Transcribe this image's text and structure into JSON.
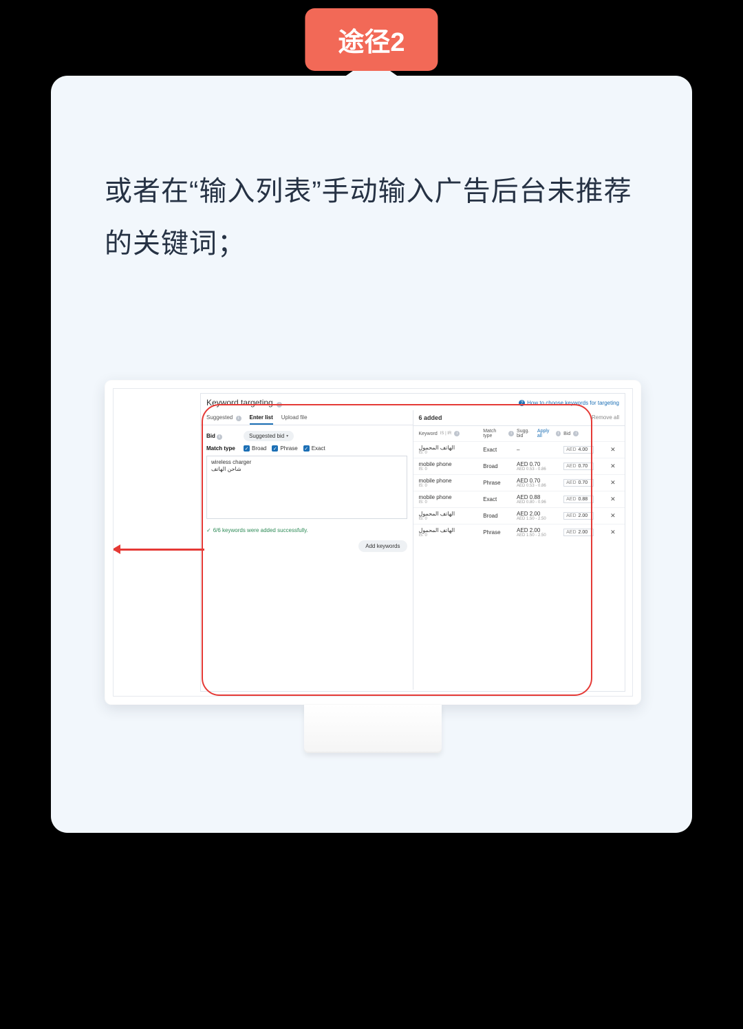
{
  "badge": "途径2",
  "description": "或者在“输入列表”手动输入广告后台未推荐的关键词；",
  "panel": {
    "title": "Keyword targeting",
    "helpLink": "How to choose keywords for targeting",
    "tabs": {
      "suggested": "Suggested",
      "enterList": "Enter list",
      "uploadFile": "Upload file"
    },
    "bidLabel": "Bid",
    "bidDropdown": "Suggested bid",
    "matchLabel": "Match type",
    "matchOptions": {
      "broad": "Broad",
      "phrase": "Phrase",
      "exact": "Exact"
    },
    "textarea": {
      "line1": "wireless charger",
      "line2": "شاحن الهاتف"
    },
    "successMsg": "6/6 keywords were added successfully.",
    "addBtn": "Add keywords",
    "addedTitle": "6 added",
    "removeAll": "Remove all",
    "headers": {
      "keyword": "Keyword",
      "keywordSub": "IS | IR",
      "match": "Match type",
      "sugg": "Sugg. bid",
      "applyAll": "Apply all",
      "bid": "Bid"
    },
    "rows": [
      {
        "kw": "الهاتف المحمول",
        "sub": "IS: 0",
        "match": "Exact",
        "sugg": "–",
        "range": "",
        "cur": "AED",
        "bid": "4.00"
      },
      {
        "kw": "mobile phone",
        "sub": "IS: 0",
        "match": "Broad",
        "sugg": "AED 0.70",
        "range": "AED 0.53 - 0.86",
        "cur": "AED",
        "bid": "0.70"
      },
      {
        "kw": "mobile phone",
        "sub": "IS: 0",
        "match": "Phrase",
        "sugg": "AED 0.70",
        "range": "AED 0.53 - 0.86",
        "cur": "AED",
        "bid": "0.70"
      },
      {
        "kw": "mobile phone",
        "sub": "IS: 0",
        "match": "Exact",
        "sugg": "AED 0.88",
        "range": "AED 0.80 - 0.96",
        "cur": "AED",
        "bid": "0.88"
      },
      {
        "kw": "الهاتف المحمول",
        "sub": "IS: 0",
        "match": "Broad",
        "sugg": "AED 2.00",
        "range": "AED 1.50 - 2.50",
        "cur": "AED",
        "bid": "2.00"
      },
      {
        "kw": "الهاتف المحمول",
        "sub": "IS: 0",
        "match": "Phrase",
        "sugg": "AED 2.00",
        "range": "AED 1.50 - 2.50",
        "cur": "AED",
        "bid": "2.00"
      }
    ]
  }
}
